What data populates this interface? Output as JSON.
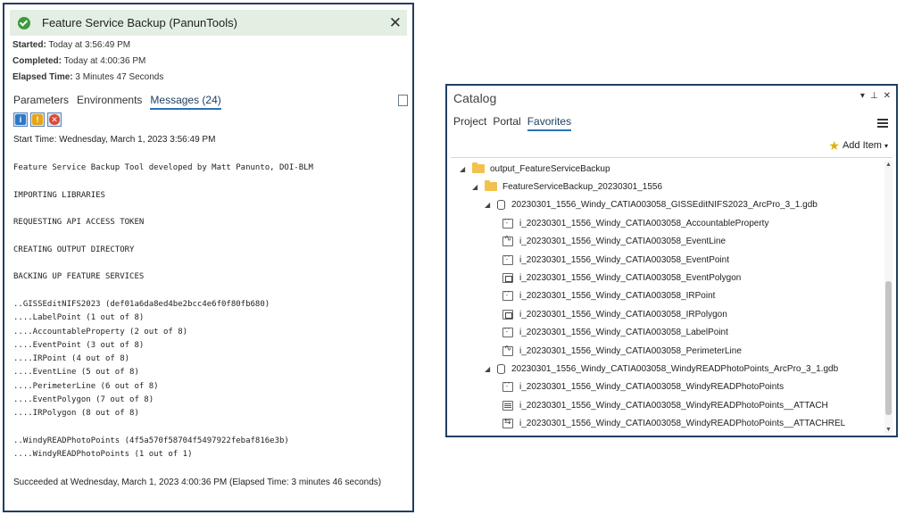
{
  "gp": {
    "title": "Feature Service Backup (PanunTools)",
    "started_label": "Started:",
    "started_value": "Today at 3:56:49 PM",
    "completed_label": "Completed:",
    "completed_value": "Today at 4:00:36 PM",
    "elapsed_label": "Elapsed Time:",
    "elapsed_value": "3 Minutes 47 Seconds",
    "tabs": [
      "Parameters",
      "Environments",
      "Messages (24)"
    ],
    "active_tab": "Messages (24)",
    "filters": [
      {
        "name": "info",
        "glyph": "i"
      },
      {
        "name": "warning",
        "glyph": "!"
      },
      {
        "name": "error",
        "glyph": "✕"
      }
    ],
    "start_time": "Start Time: Wednesday, March 1, 2023 3:56:49 PM",
    "log_lines": [
      "Feature Service Backup Tool developed by Matt Panunto, DOI-BLM",
      "",
      "IMPORTING LIBRARIES",
      "",
      "REQUESTING API ACCESS TOKEN",
      "",
      "CREATING OUTPUT DIRECTORY",
      "",
      "BACKING UP FEATURE SERVICES",
      "",
      "..GISSEditNIFS2023 (def01a6da8ed4be2bcc4e6f0f80fb680)",
      "....LabelPoint (1 out of 8)",
      "....AccountableProperty (2 out of 8)",
      "....EventPoint (3 out of 8)",
      "....IRPoint (4 out of 8)",
      "....EventLine (5 out of 8)",
      "....PerimeterLine (6 out of 8)",
      "....EventPolygon (7 out of 8)",
      "....IRPolygon (8 out of 8)",
      "",
      "..WindyREADPhotoPoints (4f5a570f58704f5497922febaf816e3b)",
      "....WindyREADPhotoPoints (1 out of 1)"
    ],
    "end_message": "Succeeded at Wednesday, March 1, 2023 4:00:36 PM (Elapsed Time: 3 minutes 46 seconds)"
  },
  "catalog": {
    "title": "Catalog",
    "controls": [
      "▾",
      "⊥",
      "✕"
    ],
    "tabs": [
      "Project",
      "Portal",
      "Favorites"
    ],
    "active_tab": "Favorites",
    "add_item": "Add Item",
    "tree": [
      {
        "level": 0,
        "icon": "folder",
        "expanded": true,
        "label": "output_FeatureServiceBackup"
      },
      {
        "level": 1,
        "icon": "folder",
        "expanded": true,
        "label": "FeatureServiceBackup_20230301_1556"
      },
      {
        "level": 2,
        "icon": "gdb",
        "expanded": true,
        "label": "20230301_1556_Windy_CATIA003058_GISSEditNIFS2023_ArcPro_3_1.gdb"
      },
      {
        "level": 3,
        "icon": "point",
        "label": "i_20230301_1556_Windy_CATIA003058_AccountableProperty"
      },
      {
        "level": 3,
        "icon": "line",
        "label": "i_20230301_1556_Windy_CATIA003058_EventLine"
      },
      {
        "level": 3,
        "icon": "point",
        "label": "i_20230301_1556_Windy_CATIA003058_EventPoint"
      },
      {
        "level": 3,
        "icon": "poly",
        "label": "i_20230301_1556_Windy_CATIA003058_EventPolygon"
      },
      {
        "level": 3,
        "icon": "point",
        "label": "i_20230301_1556_Windy_CATIA003058_IRPoint"
      },
      {
        "level": 3,
        "icon": "poly",
        "label": "i_20230301_1556_Windy_CATIA003058_IRPolygon"
      },
      {
        "level": 3,
        "icon": "point",
        "label": "i_20230301_1556_Windy_CATIA003058_LabelPoint"
      },
      {
        "level": 3,
        "icon": "line",
        "label": "i_20230301_1556_Windy_CATIA003058_PerimeterLine"
      },
      {
        "level": 2,
        "icon": "gdb",
        "expanded": true,
        "label": "20230301_1556_Windy_CATIA003058_WindyREADPhotoPoints_ArcPro_3_1.gdb"
      },
      {
        "level": 3,
        "icon": "point",
        "label": "i_20230301_1556_Windy_CATIA003058_WindyREADPhotoPoints"
      },
      {
        "level": 3,
        "icon": "table",
        "label": "i_20230301_1556_Windy_CATIA003058_WindyREADPhotoPoints__ATTACH"
      },
      {
        "level": 3,
        "icon": "rel",
        "label": "i_20230301_1556_Windy_CATIA003058_WindyREADPhotoPoints__ATTACHREL"
      }
    ]
  }
}
